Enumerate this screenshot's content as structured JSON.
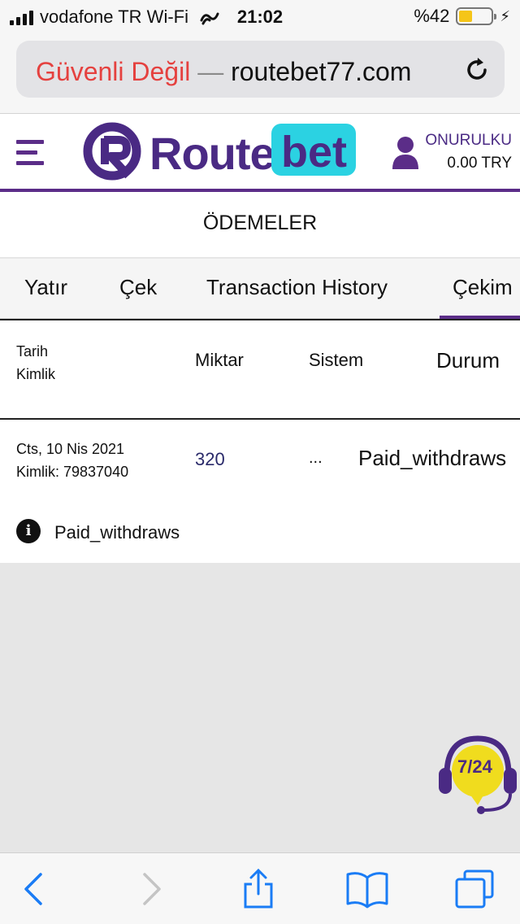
{
  "status_bar": {
    "carrier": "vodafone TR Wi-Fi",
    "time": "21:02",
    "battery": "%42",
    "battery_level": 0.42
  },
  "browser": {
    "security_warning": "Güvenli Değil",
    "separator": "—",
    "domain": "routebet77.com"
  },
  "header": {
    "logo_route": "Route",
    "logo_bet": "bet",
    "username": "ONURULKU",
    "balance": "0.00 TRY"
  },
  "page_title": "ÖDEMELER",
  "tabs": [
    {
      "label": "Yatır"
    },
    {
      "label": "Çek"
    },
    {
      "label": "Transaction History"
    },
    {
      "label": "Çekim",
      "active": true
    }
  ],
  "table": {
    "headers": {
      "date": "Tarih",
      "id": "Kimlik",
      "amount": "Miktar",
      "system": "Sistem",
      "status": "Durum"
    },
    "rows": [
      {
        "date": "Cts, 10 Nis 2021",
        "id": "Kimlik: 79837040",
        "amount": "320",
        "system": "...",
        "status": "Paid_withdraws",
        "info": "Paid_withdraws"
      }
    ]
  },
  "support_badge": "7/24",
  "colors": {
    "brand_purple": "#4a2a84",
    "brand_cyan": "#2bd2e2",
    "insecure_red": "#e5413f",
    "ios_blue": "#1a7cf5"
  }
}
